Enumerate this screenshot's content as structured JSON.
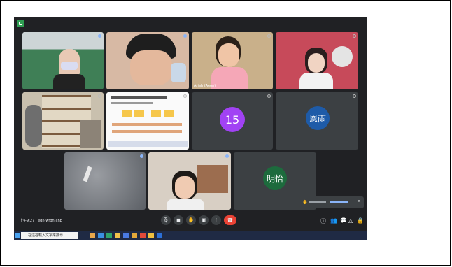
{
  "meeting": {
    "info": "上午9:27 | egn-wrgh-xnb"
  },
  "participants": [
    {
      "name": "",
      "kind": "video",
      "muted": false
    },
    {
      "name": "",
      "kind": "video",
      "muted": false
    },
    {
      "name": "Ariah (Aeon)",
      "kind": "video",
      "muted": true
    },
    {
      "name": "",
      "kind": "video",
      "muted": true
    },
    {
      "name": "",
      "kind": "video",
      "muted": true
    },
    {
      "name": "",
      "kind": "shared-screen",
      "muted": true
    },
    {
      "name": "",
      "kind": "avatar",
      "initial": "15",
      "color": "#a142f4",
      "muted": true
    },
    {
      "name": "恩雨",
      "kind": "avatar",
      "initial": "恩雨",
      "color": "#1e5ba8",
      "muted": true,
      "badge": ""
    },
    {
      "name": "",
      "kind": "video",
      "muted": false
    },
    {
      "name": "",
      "kind": "video",
      "muted": false
    },
    {
      "name": "明怡",
      "kind": "avatar",
      "initial": "明怡",
      "color": "#1d6b3d",
      "muted": true
    }
  ],
  "toast": {
    "text": ""
  },
  "taskbar": {
    "search_placeholder": "在這裡輸入文字來搜尋",
    "time": "",
    "date": ""
  },
  "colors": {
    "background": "#202124",
    "hangup": "#ea4335",
    "taskbar": "#1f2a44"
  }
}
